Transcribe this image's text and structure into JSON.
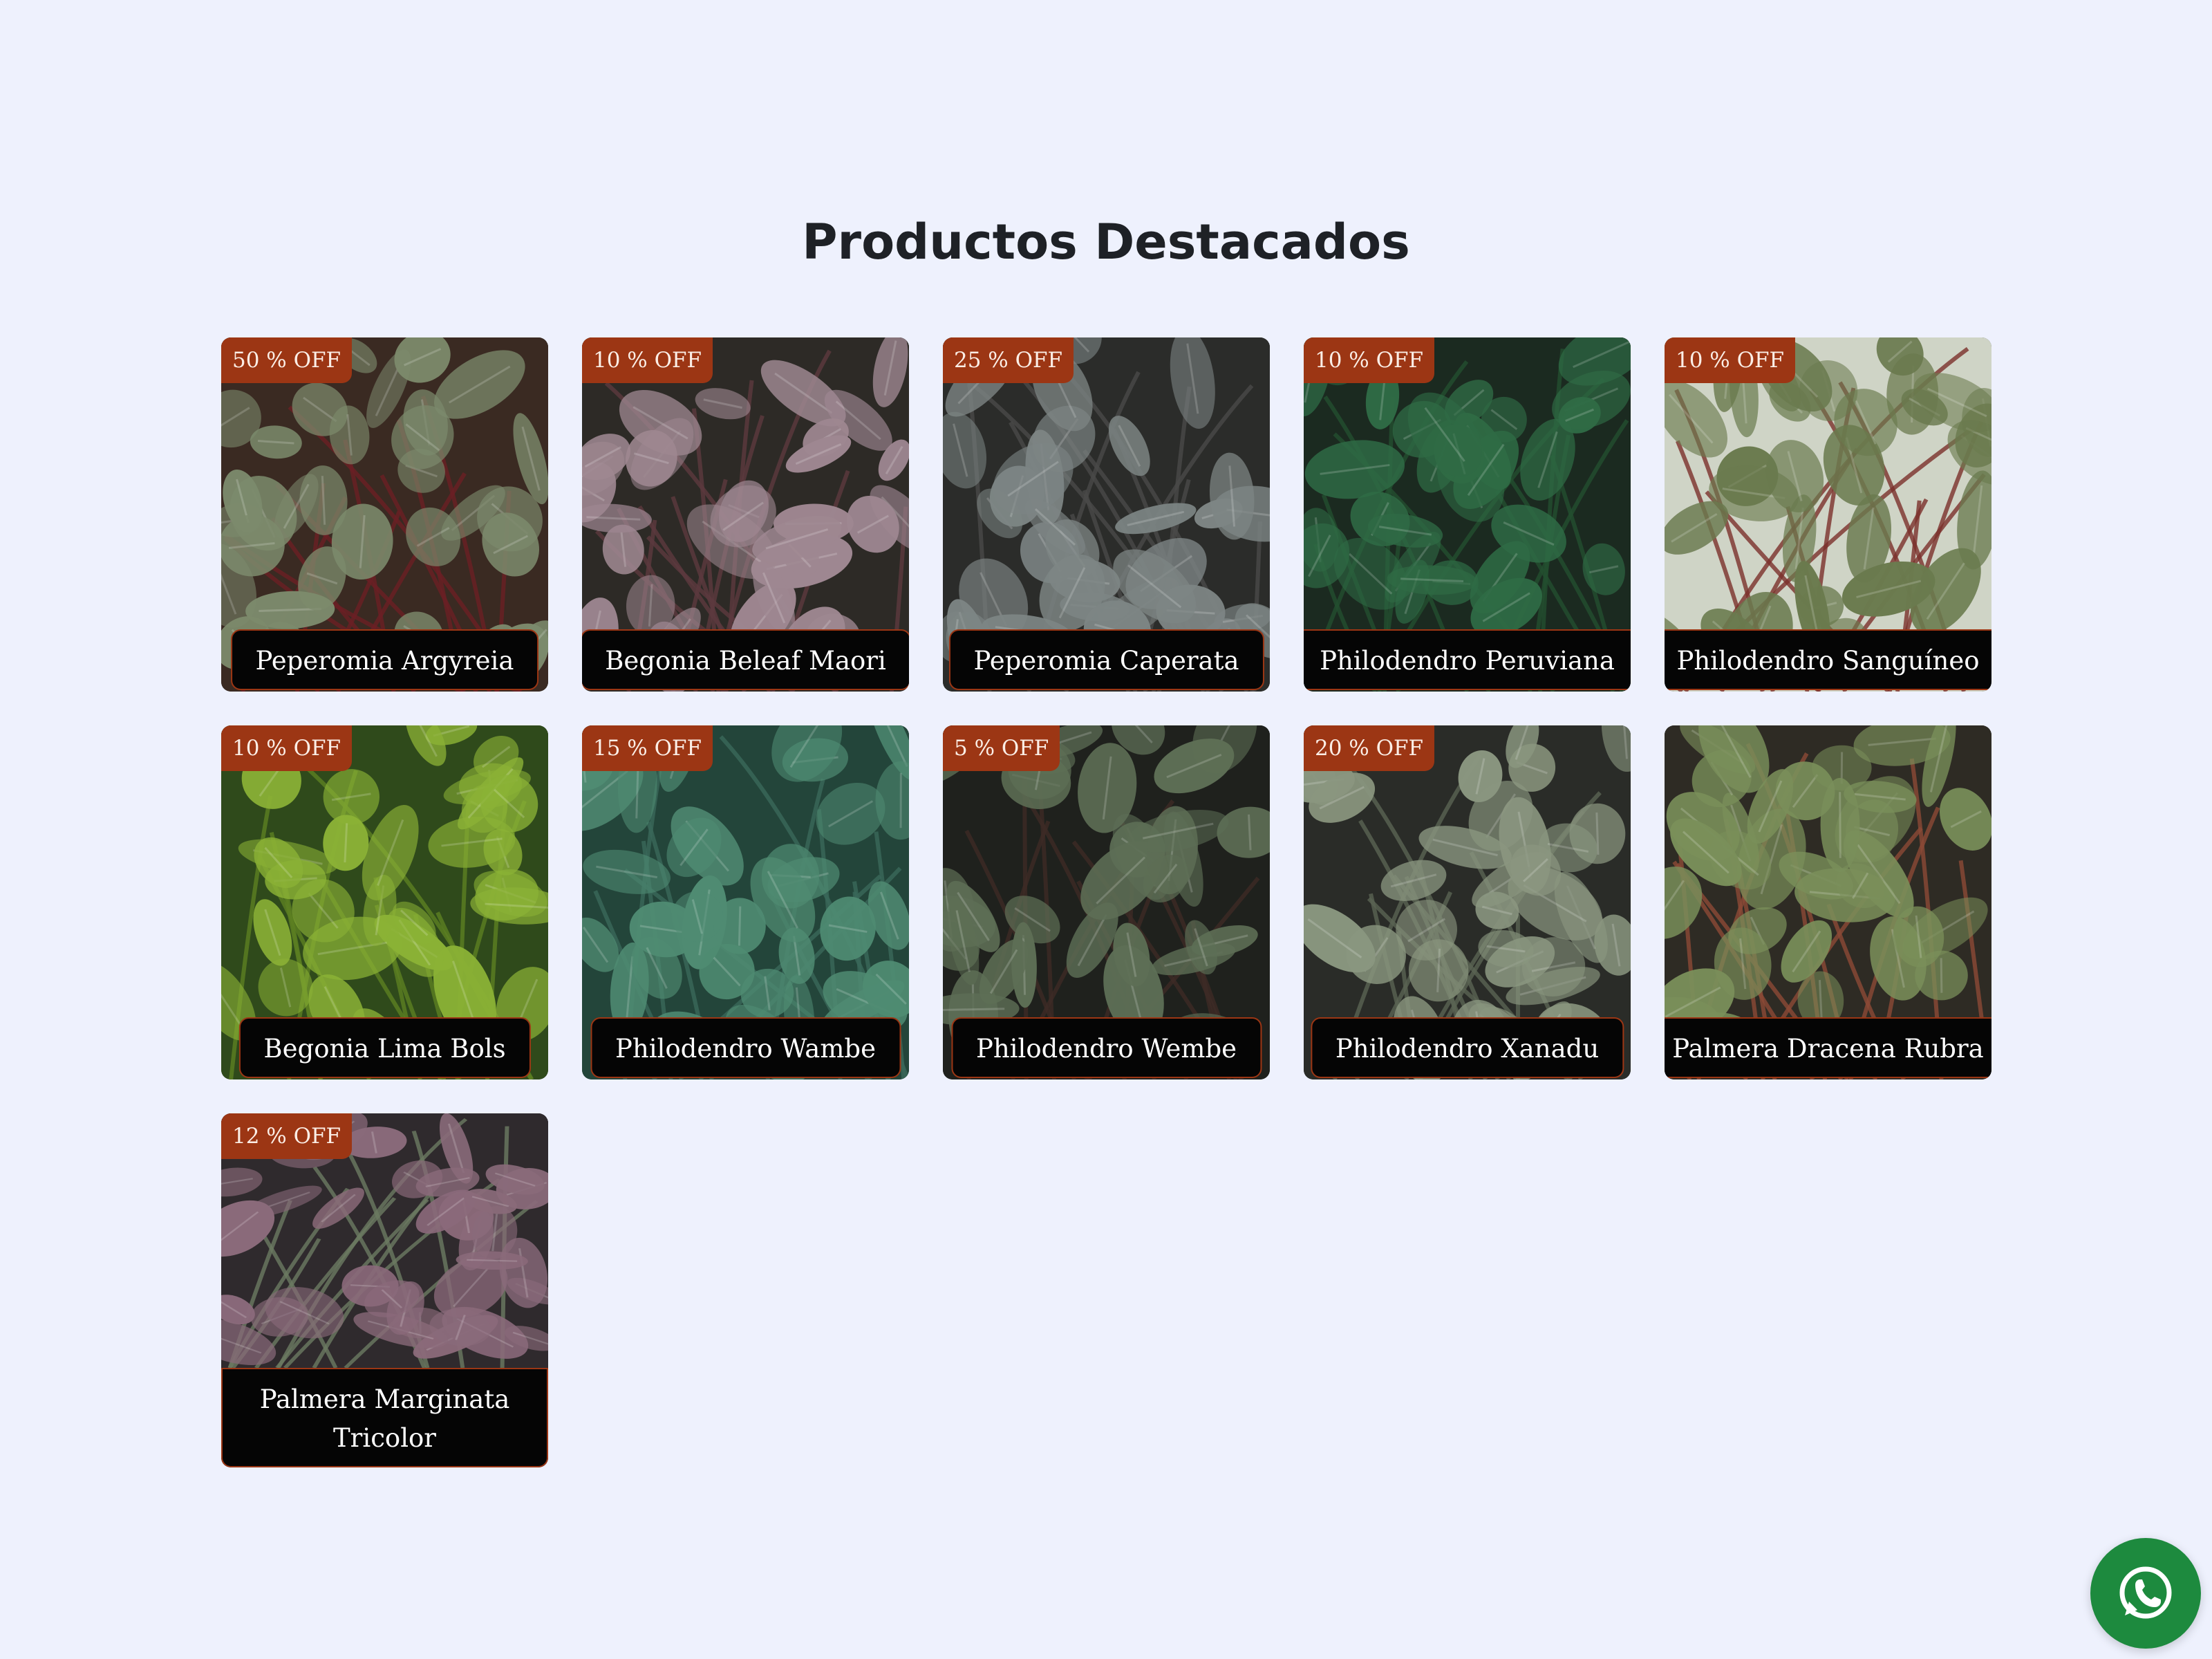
{
  "section": {
    "title": "Productos Destacados"
  },
  "products": [
    {
      "name": "Peperomia Argyreia",
      "discount": "50 % OFF",
      "leaf_color": "#7c8a6c",
      "bg_color": "#3a2a22",
      "stem_color": "#6b1f24"
    },
    {
      "name": "Begonia Beleaf Maori",
      "discount": "10 % OFF",
      "leaf_color": "#9e8791",
      "bg_color": "#2d2a26",
      "stem_color": "#5d3a3f"
    },
    {
      "name": "Peperomia Caperata",
      "discount": "25 % OFF",
      "leaf_color": "#7d8584",
      "bg_color": "#2b2c2a",
      "stem_color": "#4a4a48"
    },
    {
      "name": "Philodendro Peruviana",
      "discount": "10 % OFF",
      "leaf_color": "#2f6b45",
      "bg_color": "#1b2a20",
      "stem_color": "#234f30"
    },
    {
      "name": "Philodendro Sanguíneo",
      "discount": "10 % OFF",
      "leaf_color": "#6a7a4e",
      "bg_color": "#cfd4c6",
      "stem_color": "#7a2f2a"
    },
    {
      "name": "Begonia Lima Bols",
      "discount": "10 % OFF",
      "leaf_color": "#8bb236",
      "bg_color": "#2f4a1b",
      "stem_color": "#5d7f22"
    },
    {
      "name": "Philodendro Wambe",
      "discount": "15 % OFF",
      "leaf_color": "#4f8b72",
      "bg_color": "#23453a",
      "stem_color": "#39685a"
    },
    {
      "name": "Philodendro Wembe",
      "discount": "5 % OFF",
      "leaf_color": "#5d6e55",
      "bg_color": "#1f211d",
      "stem_color": "#3d2a26"
    },
    {
      "name": "Philodendro Xanadu",
      "discount": "20 % OFF",
      "leaf_color": "#8a967f",
      "bg_color": "#2a2c28",
      "stem_color": "#5a6452"
    },
    {
      "name": "Palmera Dracena Rubra",
      "discount": "",
      "leaf_color": "#7a8f5a",
      "bg_color": "#2e2b24",
      "stem_color": "#8c4a36"
    },
    {
      "name": "Palmera Marginata Tricolor",
      "discount": "12 % OFF",
      "leaf_color": "#8a6a7a",
      "bg_color": "#2f2a2d",
      "stem_color": "#6b7a62"
    }
  ],
  "floating": {
    "icon": "whatsapp-icon",
    "color": "#1d8a3e"
  }
}
